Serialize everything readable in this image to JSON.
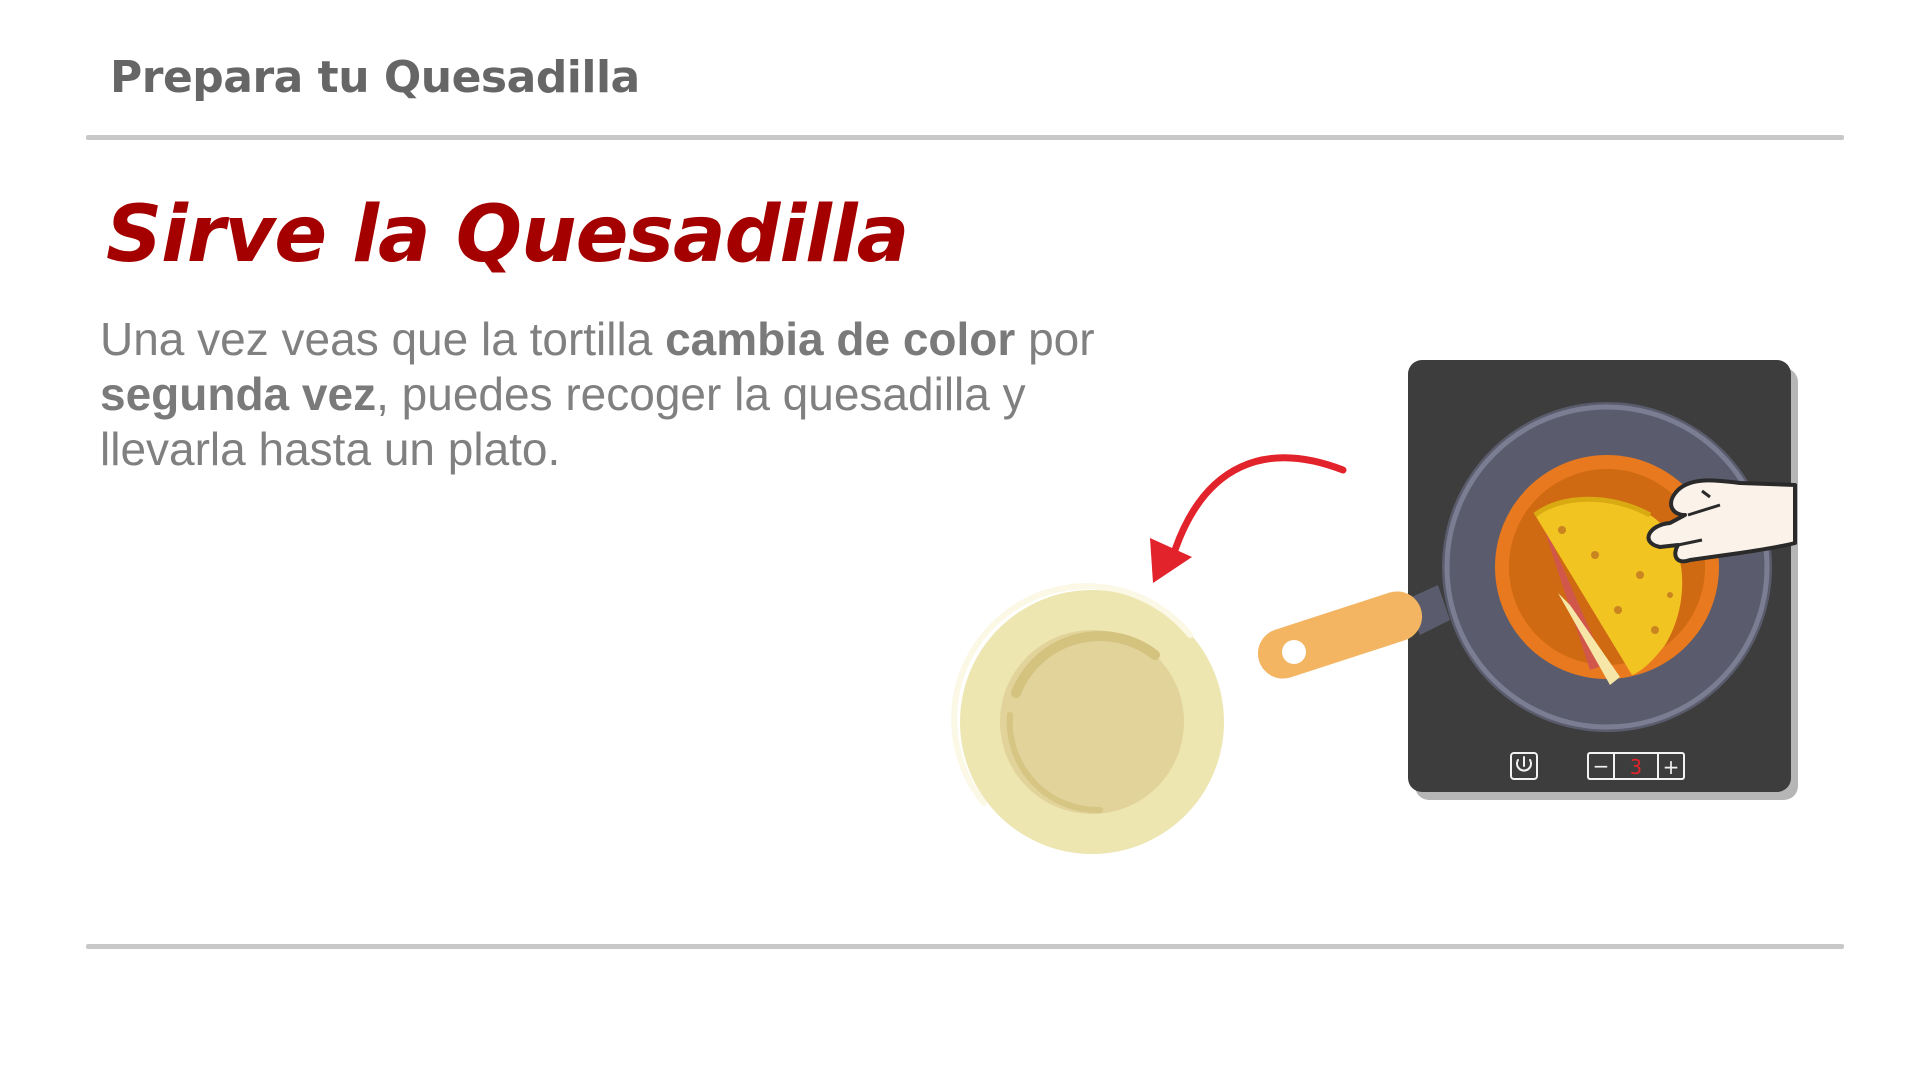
{
  "header": {
    "title": "Prepara tu Quesadilla"
  },
  "slide": {
    "title": "Sirve la Quesadilla",
    "body": {
      "part1": "Una vez veas que la tortilla ",
      "bold1": "cambia de color",
      "part2": " por ",
      "bold2": "segunda vez",
      "part3": ", puedes recoger la quesadilla y llevarla hasta un plato."
    }
  },
  "stove": {
    "power_icon": "power-icon",
    "minus_label": "−",
    "heat_level": "3",
    "plus_label": "+"
  },
  "colors": {
    "title_red": "#a50000",
    "arrow_red": "#e3232b",
    "plate": "#ede6b0",
    "plate_inner": "#e1d399",
    "stove_body": "#3d3d3d",
    "pan": "#5a5c6d",
    "handle": "#f3b562",
    "tortilla": "#f2c422"
  }
}
